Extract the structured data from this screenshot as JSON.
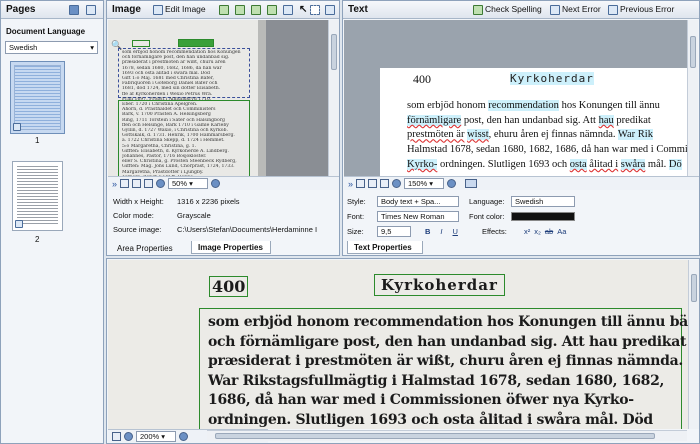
{
  "pages_panel": {
    "title": "Pages",
    "doc_language_label": "Document Language",
    "language": "Swedish",
    "thumbs": [
      {
        "num": "1"
      },
      {
        "num": "2"
      }
    ]
  },
  "image_panel": {
    "title": "Image",
    "edit_image": "Edit Image",
    "zoom": "50%",
    "props": {
      "size_label": "Width x Height:",
      "size_value": "1316 x 2236 pixels",
      "color_label": "Color mode:",
      "color_value": "Grayscale",
      "source_label": "Source image:",
      "source_value": "C:\\Users\\Stefan\\Documents\\Herdaminne I"
    },
    "tabs": [
      "Area Properties",
      "Image Properties"
    ],
    "snippet_lines": [
      "som erbjod honom recommendation hos Konungen",
      "och förnämligare post, den han undanbad sig.",
      "præsiderat i prestmöten är wißt, churu åren",
      "1678, sedan 1680, 1682, 1686, då han war",
      "1693 och osta ålitad i swåra mål. Död",
      "Gift 1:o Maj. 1681 med Christina Bäfer,",
      "Fabriquören i Göteborg Daniel Bäfer och",
      "1681, död 1724, med sin dotter Elisabeth.",
      "ffe af Kyrkoherden i Wexiö Petrus Wra.",
      "Från 1697. Probst i Almundsryd 1710.",
      "Eber. 1720 i Christina Apelgren.",
      "Ahorn, d. Prästhaldet och Comministers",
      "Bark, v. 1700 Prästen A. Helsingsberg",
      "Ring, 1711 Torstein i Säter och Hälsingborg",
      "ffen och Helsinge, Bark 1710 i Gamle Karleby",
      "Gyllin, d. 1727 Wäxiö, i Christina och Kyrkob.",
      "Gottskalk, d. 1731. Henrik, 1700 Hammarsberg.",
      "a. 1722 Christina Skepp, d. 1724 i Hemmet.",
      "5:o Margaretha, Christina, g. 1.",
      "Gifften: Elisabeth, d. Kyrkoherde A. Lindberg.",
      "Johannes, Pastor, 1716 Bosjökloster.",
      "eller S. Christina, g. Prosten Steenbeck Rydberg,",
      "Gifften: Mag. Jöns Lund, Chorpräst, 1724, 1733.",
      "Margaretha, Prästdotter i Ljungby.",
      "Torpare, Bengt 1728 ff. Hanna."
    ]
  },
  "text_panel": {
    "title": "Text",
    "check_spelling": "Check Spelling",
    "next_error": "Next Error",
    "previous_error": "Previous Error",
    "page_number": "400",
    "heading": "Kyrkoherdar",
    "line1a": "som erbjöd honom",
    "line1b": "recommendation",
    "line1c": "hos Konungen till ännu",
    "line2a": "förnämligare",
    "line2b": "post, den han undanbad sig. Att",
    "line2c": "hau",
    "line2d": "predikat",
    "line3a": "prestmöten är",
    "line3b": "wisst",
    "line3c": ", ehuru åren ej finnas nämnda.",
    "line3d": "War Rik",
    "line4a": "Halmstad 1678, sedan 1680, 1682, 1686, då han war med i Commi",
    "line5a": "Kyrko-",
    "line5b": " ordningen. Slutligen 1693 och",
    "line5c": "osta",
    "line5d": "ålitad i",
    "line5e": "swåra",
    "line5f": "mål.",
    "line5g": "Dö",
    "zoom": "150%",
    "props": {
      "style_label": "Style:",
      "style_value": "Body text + Spa...",
      "language_label": "Language:",
      "language_value": "Swedish",
      "font_label": "Font:",
      "font_value": "Times New Roman",
      "fontcolor_label": "Font color:",
      "size_label": "Size:",
      "size_value": "9,5",
      "effects_label": "Effects:"
    },
    "tab": "Text Properties"
  },
  "zoom_panel": {
    "page_number": "400",
    "heading": "Kyrkoherdar",
    "lines": [
      "som erbjöd honom recommendation hos Konungen till ännu bättre",
      "och förnämligare post, den han undanbad sig. Att hau predikat och",
      "præsiderat i prestmöten är wißt, churu åren ej finnas nämnda.",
      "War Rikstagsfullmägtig i Halmstad 1678, sedan 1680, 1682,",
      "1686, då han war med i Commissionen öfwer nya Kyrko-",
      "ordningen. Slutligen 1693 och osta ålitad i swåra mål. Död"
    ],
    "zoom": "200%"
  }
}
